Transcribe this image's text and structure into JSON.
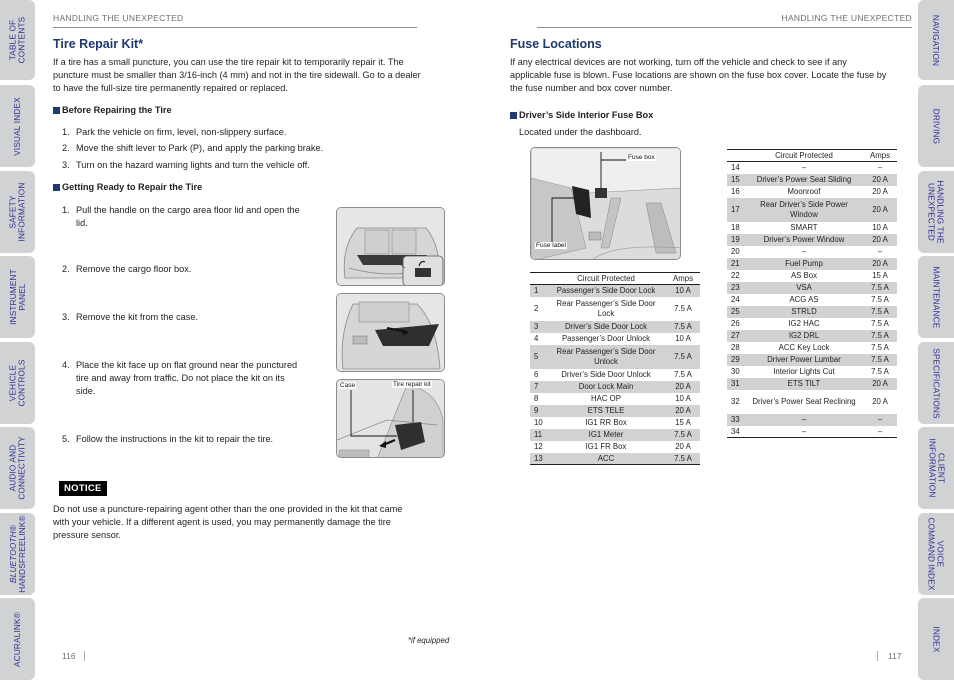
{
  "tabs_left": [
    {
      "label_lines": [
        "TABLE OF",
        "CONTENTS"
      ]
    },
    {
      "label_lines": [
        "VISUAL INDEX"
      ]
    },
    {
      "label_lines": [
        "SAFETY",
        "INFORMATION"
      ]
    },
    {
      "label_lines": [
        "INSTRUMENT",
        "PANEL"
      ]
    },
    {
      "label_lines": [
        "VEHICLE",
        "CONTROLS"
      ]
    },
    {
      "label_lines": [
        "AUDIO AND",
        "CONNECTIVITY"
      ]
    },
    {
      "label_lines": [
        "BLUETOOTH®",
        "HANDSFREELINK®"
      ]
    },
    {
      "label_lines": [
        "ACURALINK®"
      ]
    }
  ],
  "tabs_right": [
    {
      "label_lines": [
        "NAVIGATION"
      ]
    },
    {
      "label_lines": [
        "DRIVING"
      ]
    },
    {
      "label_lines": [
        "HANDLING THE",
        "UNEXPECTED"
      ]
    },
    {
      "label_lines": [
        "MAINTENANCE"
      ]
    },
    {
      "label_lines": [
        "SPECIFICATIONS"
      ]
    },
    {
      "label_lines": [
        "CLIENT",
        "INFORMATION"
      ]
    },
    {
      "label_lines": [
        "VOICE",
        "COMMAND INDEX"
      ]
    },
    {
      "label_lines": [
        "INDEX"
      ]
    }
  ],
  "left_page": {
    "running_head": "HANDLING THE UNEXPECTED",
    "title": "Tire Repair Kit*",
    "intro_lines": [
      "If a tire has a small puncture, you can use the tire repair kit to temporarily repair it. The",
      "puncture must be smaller than 3/16-inch (4 mm) and not in the tire sidewall. Go to a dealer",
      "to have the full-size tire permanently repaired or replaced."
    ],
    "before_heading": "Before Repairing the Tire",
    "before_steps": [
      {
        "num": "1.",
        "text": "Park the vehicle on firm, level, non-slippery surface."
      },
      {
        "num": "2.",
        "text": "Move the shift lever to Park (P), and apply the parking brake."
      },
      {
        "num": "3.",
        "text": "Turn on the hazard warning lights and turn the vehicle off."
      }
    ],
    "ready_heading": "Getting Ready to Repair the Tire",
    "ready_steps": [
      {
        "num": "1.",
        "lines": [
          "Pull the handle on the cargo area floor lid and open the",
          "lid."
        ]
      },
      {
        "num": "2.",
        "lines": [
          "Remove the cargo floor box."
        ]
      },
      {
        "num": "3.",
        "lines": [
          "Remove the kit from the case."
        ]
      },
      {
        "num": "4.",
        "lines": [
          "Place the kit face up on flat ground near the punctured",
          "tire and away from traffic. Do not place the kit on its",
          "side."
        ]
      },
      {
        "num": "5.",
        "lines": [
          "Follow the instructions in the kit to repair the tire."
        ]
      }
    ],
    "figure3_labels": {
      "case": "Case",
      "kit": "Tire repair kit"
    },
    "notice_label": "NOTICE",
    "notice_lines": [
      "Do not use a puncture-repairing agent other than the one provided in the kit that came",
      "with your vehicle. If a different agent is used, you may permanently damage the tire",
      "pressure sensor."
    ],
    "footnote": "*if equipped",
    "page_number": "116"
  },
  "right_page": {
    "running_head": "HANDLING THE UNEXPECTED",
    "title": "Fuse Locations",
    "intro_lines": [
      "If any electrical devices are not working, turn off the vehicle and check to see if any",
      "applicable fuse is blown. Fuse locations are shown on the fuse box cover. Locate the fuse by",
      "the fuse number and box cover number."
    ],
    "subheading": "Driver’s Side Interior Fuse Box",
    "sublocation": "Located under the dashboard.",
    "figure_labels": {
      "fuse_box": "Fuse box",
      "fuse_label": "Fuse label"
    },
    "table_headers": {
      "circuit": "Circuit Protected",
      "amps": "Amps"
    },
    "table1": [
      {
        "n": "1",
        "circuit": "Passenger’s Side Door Lock",
        "amps": "10 A"
      },
      {
        "n": "2",
        "circuit": "Rear Passenger’s Side Door Lock",
        "amps": "7.5 A"
      },
      {
        "n": "3",
        "circuit": "Driver’s Side Door Lock",
        "amps": "7.5 A"
      },
      {
        "n": "4",
        "circuit": "Passenger’s Door Unlock",
        "amps": "10 A"
      },
      {
        "n": "5",
        "circuit": "Rear Passenger’s Side Door Unlock",
        "amps": "7.5 A"
      },
      {
        "n": "6",
        "circuit": "Driver’s Side Door Unlock",
        "amps": "7.5 A"
      },
      {
        "n": "7",
        "circuit": "Door Lock Main",
        "amps": "20 A"
      },
      {
        "n": "8",
        "circuit": "HAC OP",
        "amps": "10 A"
      },
      {
        "n": "9",
        "circuit": "ETS TELE",
        "amps": "20 A"
      },
      {
        "n": "10",
        "circuit": "IG1 RR Box",
        "amps": "15 A"
      },
      {
        "n": "11",
        "circuit": "IG1 Meter",
        "amps": "7.5 A"
      },
      {
        "n": "12",
        "circuit": "IG1 FR Box",
        "amps": "20 A"
      },
      {
        "n": "13",
        "circuit": "ACC",
        "amps": "7.5 A"
      }
    ],
    "table2": [
      {
        "n": "14",
        "circuit": "–",
        "amps": "–"
      },
      {
        "n": "15",
        "circuit": "Driver’s Power Seat Sliding",
        "amps": "20 A"
      },
      {
        "n": "16",
        "circuit": "Moonroof",
        "amps": "20 A"
      },
      {
        "n": "17",
        "circuit": "Rear Driver’s Side Power Window",
        "amps": "20 A"
      },
      {
        "n": "18",
        "circuit": "SMART",
        "amps": "10 A"
      },
      {
        "n": "19",
        "circuit": "Driver’s Power Window",
        "amps": "20 A"
      },
      {
        "n": "20",
        "circuit": "–",
        "amps": "–"
      },
      {
        "n": "21",
        "circuit": "Fuel Pump",
        "amps": "20 A"
      },
      {
        "n": "22",
        "circuit": "AS Box",
        "amps": "15 A"
      },
      {
        "n": "23",
        "circuit": "VSA",
        "amps": "7.5 A"
      },
      {
        "n": "24",
        "circuit": "ACG AS",
        "amps": "7.5 A"
      },
      {
        "n": "25",
        "circuit": "STRLD",
        "amps": "7.5 A"
      },
      {
        "n": "26",
        "circuit": "IG2 HAC",
        "amps": "7.5 A"
      },
      {
        "n": "27",
        "circuit": "IG2 DRL",
        "amps": "7.5 A"
      },
      {
        "n": "28",
        "circuit": "ACC Key Lock",
        "amps": "7.5 A"
      },
      {
        "n": "29",
        "circuit": "Driver Power Lumbar",
        "amps": "7.5 A"
      },
      {
        "n": "30",
        "circuit": "Interior Lights Cut",
        "amps": "7.5 A"
      },
      {
        "n": "31",
        "circuit": "ETS TILT",
        "amps": "20 A"
      },
      {
        "n": "32",
        "circuit": "Driver’s Power Seat Reclining",
        "amps": "20 A"
      },
      {
        "n": "33",
        "circuit": "–",
        "amps": "–"
      },
      {
        "n": "34",
        "circuit": "–",
        "amps": "–"
      }
    ],
    "page_number": "117"
  }
}
